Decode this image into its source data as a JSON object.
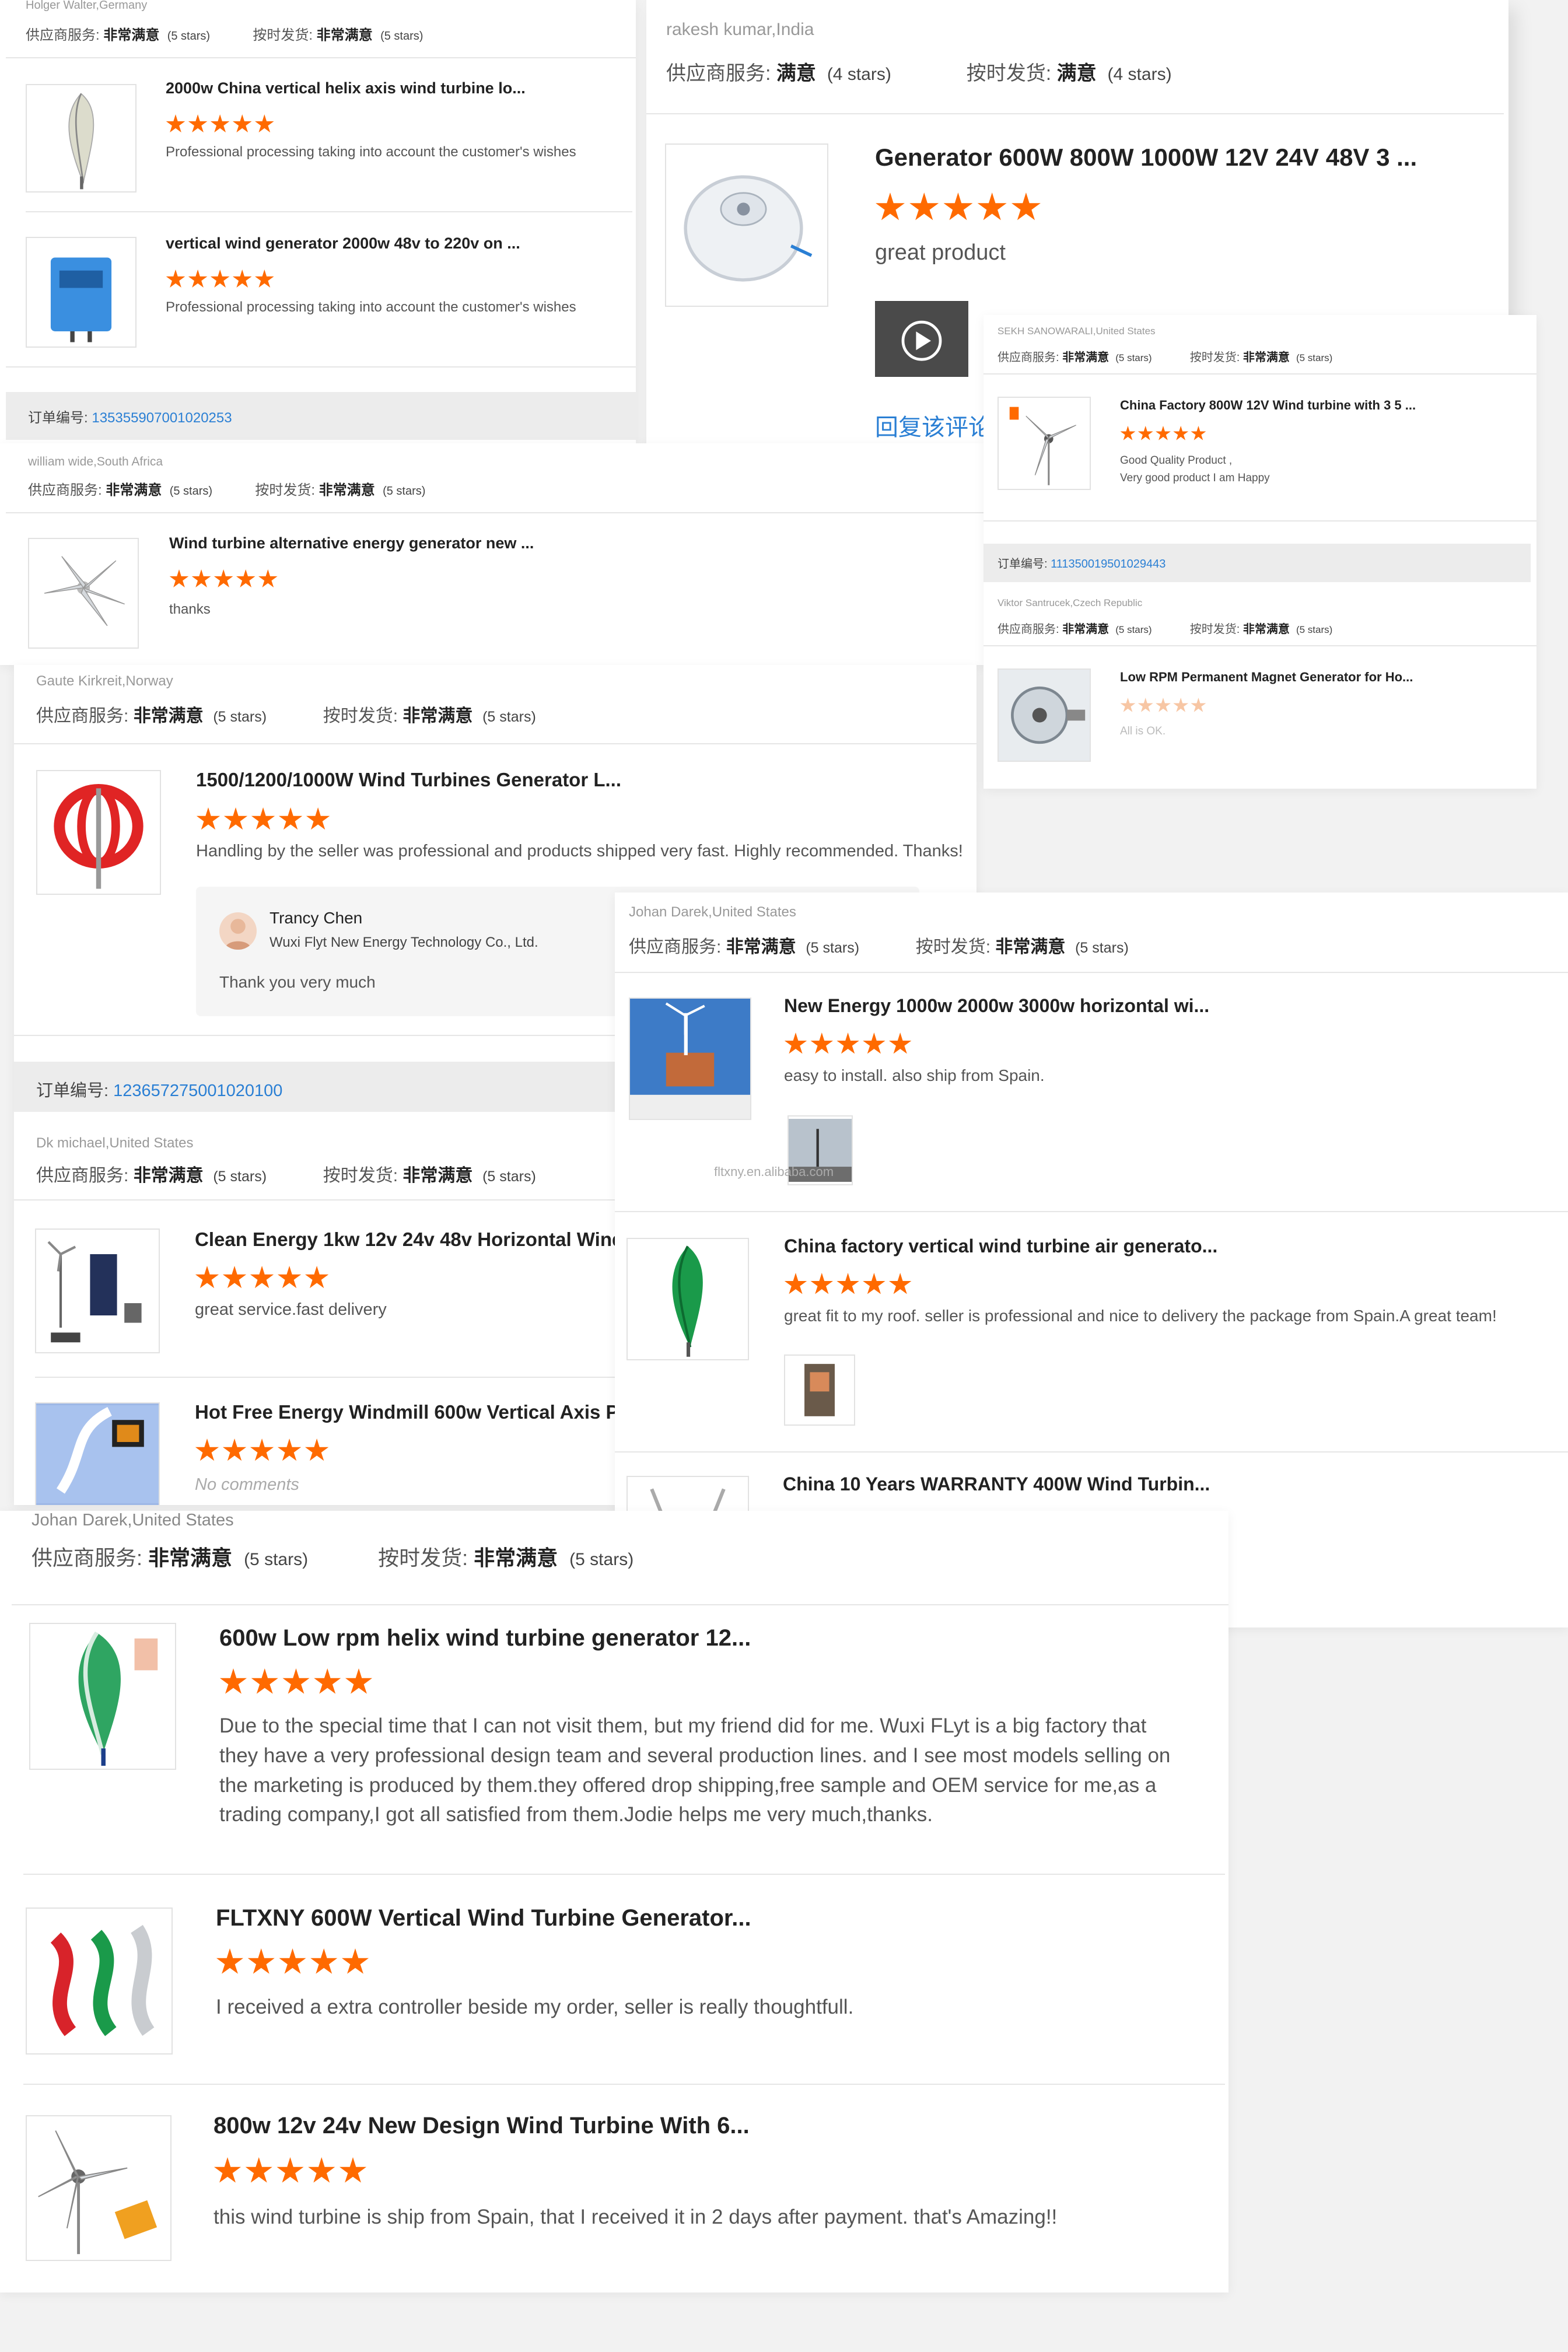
{
  "accent": {
    "star": "#ff6a00",
    "star_faded": "#f7c6a4",
    "link": "#2a7fd4"
  },
  "labels": {
    "supplier_service": "供应商服务:",
    "on_time_delivery": "按时发货:",
    "very_satisfied": "非常满意",
    "satisfied": "满意",
    "five_stars": "(5 stars)",
    "four_stars": "(4 stars)",
    "order_no": "订单编号:"
  },
  "panel_a": {
    "reviewer": "Holger Walter,Germany",
    "items": [
      {
        "title": "2000w China vertical helix axis wind turbine lo...",
        "stars": 5,
        "text": "Professional processing taking into account the customer's wishes",
        "image_icon": "helix-turbine-icon"
      },
      {
        "title": "vertical wind generator 2000w 48v to 220v on ...",
        "stars": 5,
        "text": "Professional processing taking into account the customer's wishes",
        "image_icon": "grid-inverter-icon"
      }
    ],
    "order_no": "135355907001020253"
  },
  "panel_b": {
    "reviewer": "rakesh kumar,India",
    "title": "Generator 600W 800W 1000W 12V 24V 48V 3 ...",
    "stars": 5,
    "text": "great product",
    "reply_link": "回复该评论",
    "image_icon": "generator-icon",
    "video_icon": "video-play-icon"
  },
  "panel_c": {
    "reviewer": "william wide,South Africa",
    "title": "Wind turbine alternative energy generator new ...",
    "stars": 5,
    "text": "thanks",
    "image_icon": "wind-turbine-icon"
  },
  "panel_d": {
    "reviewer": "SEKH SANOWARALI,United States",
    "title": "China Factory 800W 12V Wind turbine with 3 5 ...",
    "stars": 5,
    "text_lines": [
      "Good Quality Product ,",
      "Very good product I am Happy"
    ],
    "order_no": "111350019501029443",
    "reviewer2": "Viktor Santrucek,Czech Republic",
    "title2": "Low RPM Permanent Magnet Generator for Ho...",
    "stars2": 5,
    "text2": "All is OK."
  },
  "panel_e": {
    "reviewer": "Gaute Kirkreit,Norway",
    "title": "1500/1200/1000W Wind Turbines Generator L...",
    "stars": 5,
    "text": "Handling by the seller was professional and products shipped very fast. Highly recommended. Thanks!",
    "reply": {
      "name": "Trancy Chen",
      "company": "Wuxi Flyt New Energy Technology Co., Ltd.",
      "text": "Thank you very much"
    },
    "order_no": "123657275001020100",
    "reviewer2": "Dk michael,United States",
    "items": [
      {
        "title": "Clean Energy 1kw 12v 24v 48v Horizontal Wind",
        "stars": 5,
        "text": "great service.fast delivery"
      },
      {
        "title": "Hot Free Energy Windmill 600w Vertical Axis P...",
        "stars": 5,
        "text": "No comments"
      }
    ]
  },
  "panel_f": {
    "reviewer": "Johan Darek,United States",
    "items": [
      {
        "title": "New Energy 1000w 2000w 3000w horizontal wi...",
        "stars": 5,
        "text": "easy to install. also ship from Spain."
      },
      {
        "title": "China factory vertical wind turbine air generato...",
        "stars": 5,
        "text": "great fit to my roof. seller is professional and nice to delivery the package from Spain.A great team!"
      },
      {
        "title": "China 10 Years WARRANTY 400W Wind Turbin..."
      }
    ],
    "watermark": "fltxny.en.alibaba.com"
  },
  "panel_g": {
    "reviewer": "Johan Darek,United States",
    "items": [
      {
        "title": "600w Low rpm helix wind turbine generator 12...",
        "stars": 5,
        "text": "Due to the special time that I can not visit them, but my friend did for me. Wuxi FLyt is a big factory that they have a very professional design team and several production lines. and I see most models selling on the marketing is produced by them.they offered drop shipping,free sample and OEM service for me,as a trading company,I got all satisfied from them.Jodie helps me very much,thanks."
      },
      {
        "title": "FLTXNY 600W Vertical Wind Turbine Generator...",
        "stars": 5,
        "text": "I received a extra controller beside my order, seller is really thoughtfull."
      },
      {
        "title": "800w 12v 24v New Design Wind Turbine With 6...",
        "stars": 5,
        "text": "this wind turbine is ship from Spain, that I received it in 2 days after payment. that's Amazing!!"
      }
    ]
  }
}
